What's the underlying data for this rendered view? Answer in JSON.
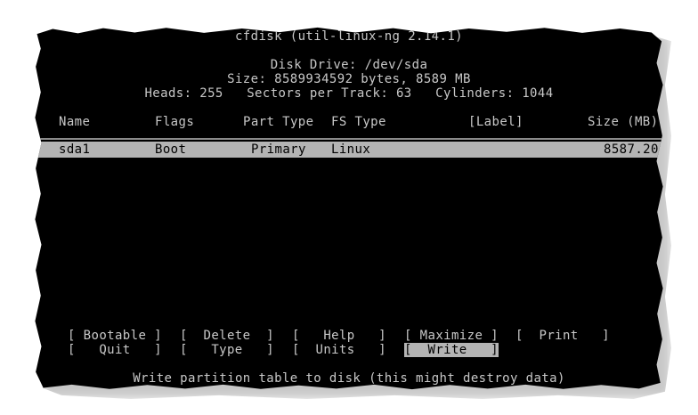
{
  "header": {
    "title": "cfdisk (util-linux-ng 2.14.1)",
    "disk_drive": "Disk Drive: /dev/sda",
    "size": "Size: 8589934592 bytes, 8589 MB",
    "geometry": "Heads: 255   Sectors per Track: 63   Cylinders: 1044"
  },
  "table": {
    "columns": {
      "name": "Name",
      "flags": "Flags",
      "part_type": "Part Type",
      "fs_type": "FS Type",
      "label": "[Label]",
      "size": "Size (MB)"
    },
    "rows": [
      {
        "name": "sda1",
        "flags": "Boot",
        "part_type": "Primary",
        "fs_type": "Linux",
        "label": "",
        "size": "8587.20"
      }
    ]
  },
  "menu": {
    "bootable": "[ Bootable ]",
    "delete": "[  Delete  ]",
    "help": "[   Help   ]",
    "maximize": "[ Maximize ]",
    "print": "[  Print   ]",
    "quit": "[   Quit   ]",
    "type": "[   Type   ]",
    "units": "[  Units   ]",
    "write": "[  Write   ]",
    "selected": "write"
  },
  "status": {
    "message": "Write partition table to disk (this might destroy data)"
  }
}
